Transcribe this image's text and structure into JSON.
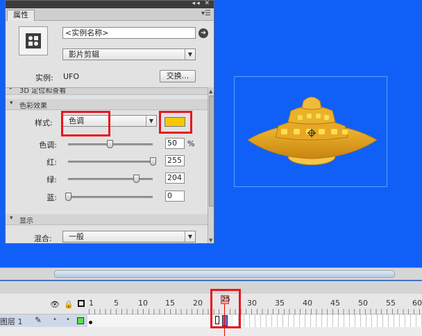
{
  "panel": {
    "tab_label": "属性",
    "window_buttons": "◂◂ ✕",
    "menu_icon": "menu-icon",
    "instance_name_placeholder": "<实例名称>",
    "symbol_type": "影片剪辑",
    "instance_label": "实例:",
    "instance_value": "UFO",
    "swap_label": "交换...",
    "sections": {
      "position_label": "3D 定位和查看",
      "color_effect_label": "色彩效果",
      "display_label": "显示"
    },
    "style_label": "样式:",
    "style_value": "色调",
    "tint_color": "#f9c700",
    "tint_label": "色调:",
    "tint_value": "50",
    "percent_sign": "%",
    "red_label": "红:",
    "red_value": "255",
    "green_label": "绿:",
    "green_value": "204",
    "blue_label": "蓝:",
    "blue_value": "0",
    "blend_label": "混合:",
    "blend_value": "一般"
  },
  "timeline": {
    "frame_numbers": [
      "1",
      "5",
      "10",
      "15",
      "20",
      "25",
      "30",
      "35",
      "40",
      "45",
      "50",
      "55",
      "60"
    ],
    "current_frame": "25",
    "layer_name": "图层 1",
    "layer_color": "#55e255"
  },
  "colors": {
    "stage": "#1060f8",
    "highlight": "#e8141e",
    "ufo_body": "#e0a020"
  }
}
